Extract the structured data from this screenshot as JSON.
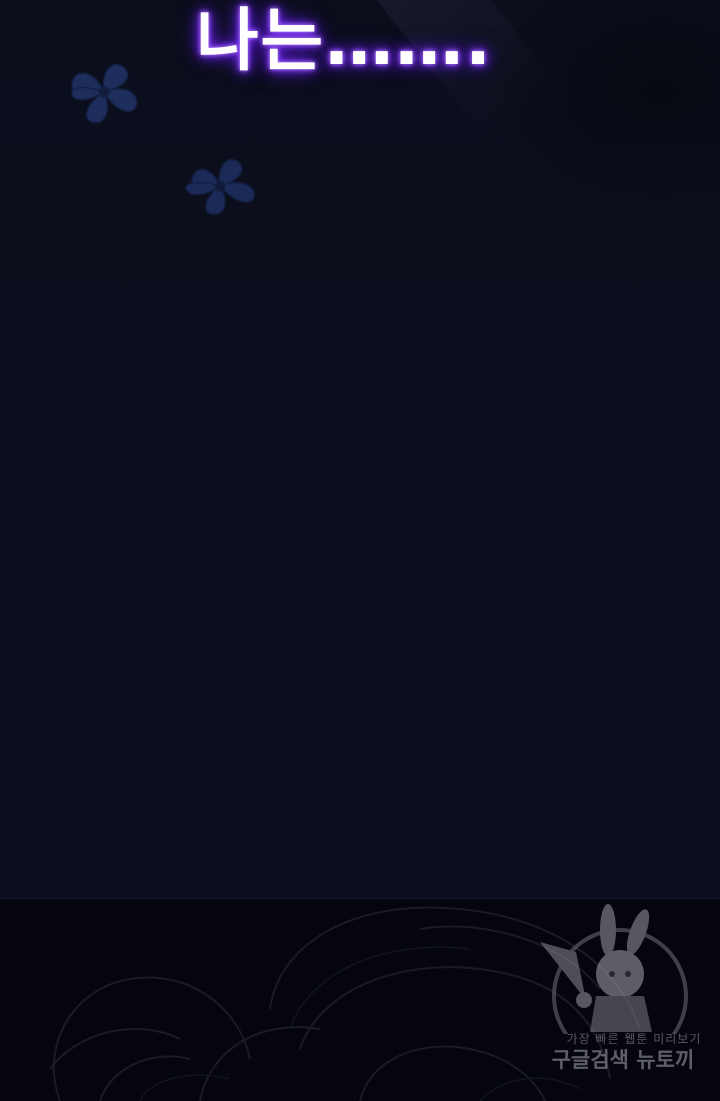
{
  "panel_top": {
    "dialogue_text": "나는……."
  },
  "watermark": {
    "line1": "가장 빠른 웹툰 미리보기",
    "line2": "구글검색 뉴토끼"
  },
  "colors": {
    "background": "#0b0e1b",
    "text_glow": "#8a3dff",
    "petal": "#1d2d5c",
    "bottom_panel": "#05060d"
  },
  "icons": [
    "flower-petal-icon",
    "flower-petal-icon",
    "bunny-mascot-icon"
  ]
}
